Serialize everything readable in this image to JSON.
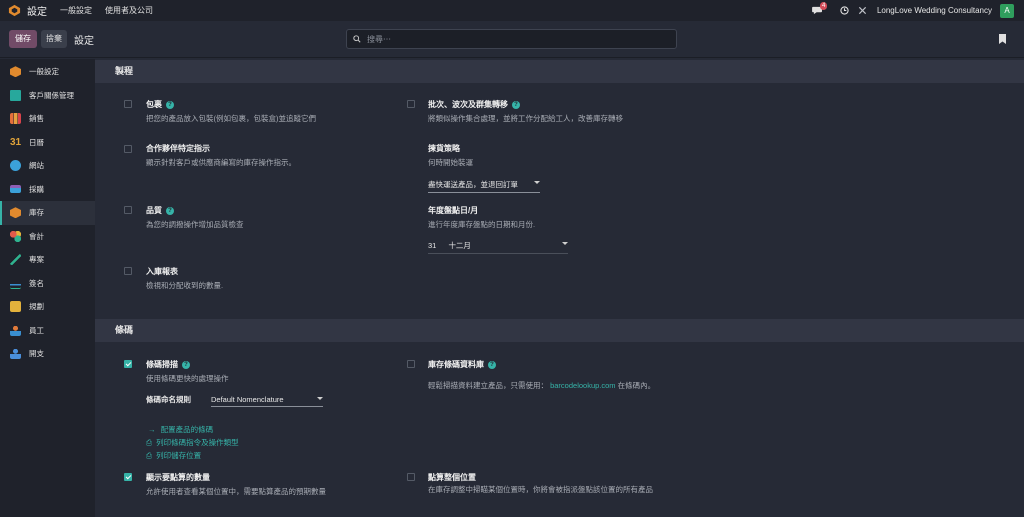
{
  "topbar": {
    "app_title": "設定",
    "menu": [
      "一般設定",
      "使用者及公司"
    ],
    "notification_count": "4",
    "company": "LongLove Wedding Consultancy",
    "avatar_initial": "A"
  },
  "toolbar": {
    "save_label": "儲存",
    "discard_label": "捨棄",
    "title": "設定",
    "search_placeholder": "搜尋⋯"
  },
  "sidebar": {
    "items": [
      {
        "label": "一般設定",
        "color": "#e08a2e"
      },
      {
        "label": "客戶關係管理",
        "color": "#27a89c"
      },
      {
        "label": "銷售",
        "color": "#e5703b"
      },
      {
        "label": "日曆",
        "color": "#e0a33a"
      },
      {
        "label": "網站",
        "color": "#3ba1d9"
      },
      {
        "label": "採購",
        "color": "#8e5fb5"
      },
      {
        "label": "庫存",
        "color": "#e08a2e"
      },
      {
        "label": "會計",
        "color": "#e05b4b"
      },
      {
        "label": "專案",
        "color": "#2fb38f"
      },
      {
        "label": "簽名",
        "color": "#3a8fd0"
      },
      {
        "label": "規劃",
        "color": "#e3b23c"
      },
      {
        "label": "員工",
        "color": "#e07a3a"
      },
      {
        "label": "開支",
        "color": "#4a8fdb"
      }
    ],
    "active_index": 6
  },
  "sections": {
    "manufacturing": {
      "title": "製程",
      "packages": {
        "title": "包裹",
        "desc": "把您的產品放入包裝(例如包裹，包裝盒)並追蹤它們"
      },
      "batch": {
        "title": "批次、波次及群集轉移",
        "desc": "將類似操作集合處理，並將工作分配給工人，改善庫存轉移"
      },
      "consignment": {
        "title": "合作夥伴特定指示",
        "desc": "顯示針對客戶或供應商編寫的庫存操作指示。"
      },
      "picking_policy": {
        "title": "揀貨策略",
        "desc": "何時開始裝運",
        "value": "盡快運送產品，並退回訂單"
      },
      "quality": {
        "title": "品質",
        "desc": "為您的調撥操作增加品質檢查"
      },
      "annual_inventory": {
        "title": "年度盤點日/月",
        "desc": "進行年度庫存盤點的日期和月份.",
        "day": "31",
        "month": "十二月"
      },
      "receipt_report": {
        "title": "入庫報表",
        "desc": "檢視和分配收到的數量."
      }
    },
    "barcode": {
      "title": "條碼",
      "scanner": {
        "title": "條碼掃描",
        "desc": "使用條碼更快的處理操作",
        "nomenclature_label": "條碼命名規則",
        "nomenclature_value": "Default Nomenclature",
        "links": [
          "配置產品的條碼",
          "列印條碼指令及操作類型",
          "列印儲存位置"
        ]
      },
      "database": {
        "title": "庫存條碼資料庫",
        "desc_prefix": "輕鬆掃描資料建立產品，只需使用：",
        "desc_link": "barcodelookup.com",
        "desc_suffix": "在條碼內。"
      },
      "show_quantity": {
        "title": "顯示要點算的數量",
        "desc": "允許使用者查看某個位置中，需要點算產品的預期數量"
      },
      "count_location": {
        "title": "點算整個位置",
        "desc": "在庫存調整中掃瞄某個位置時，你將會被指派盤點該位置的所有產品"
      }
    }
  }
}
